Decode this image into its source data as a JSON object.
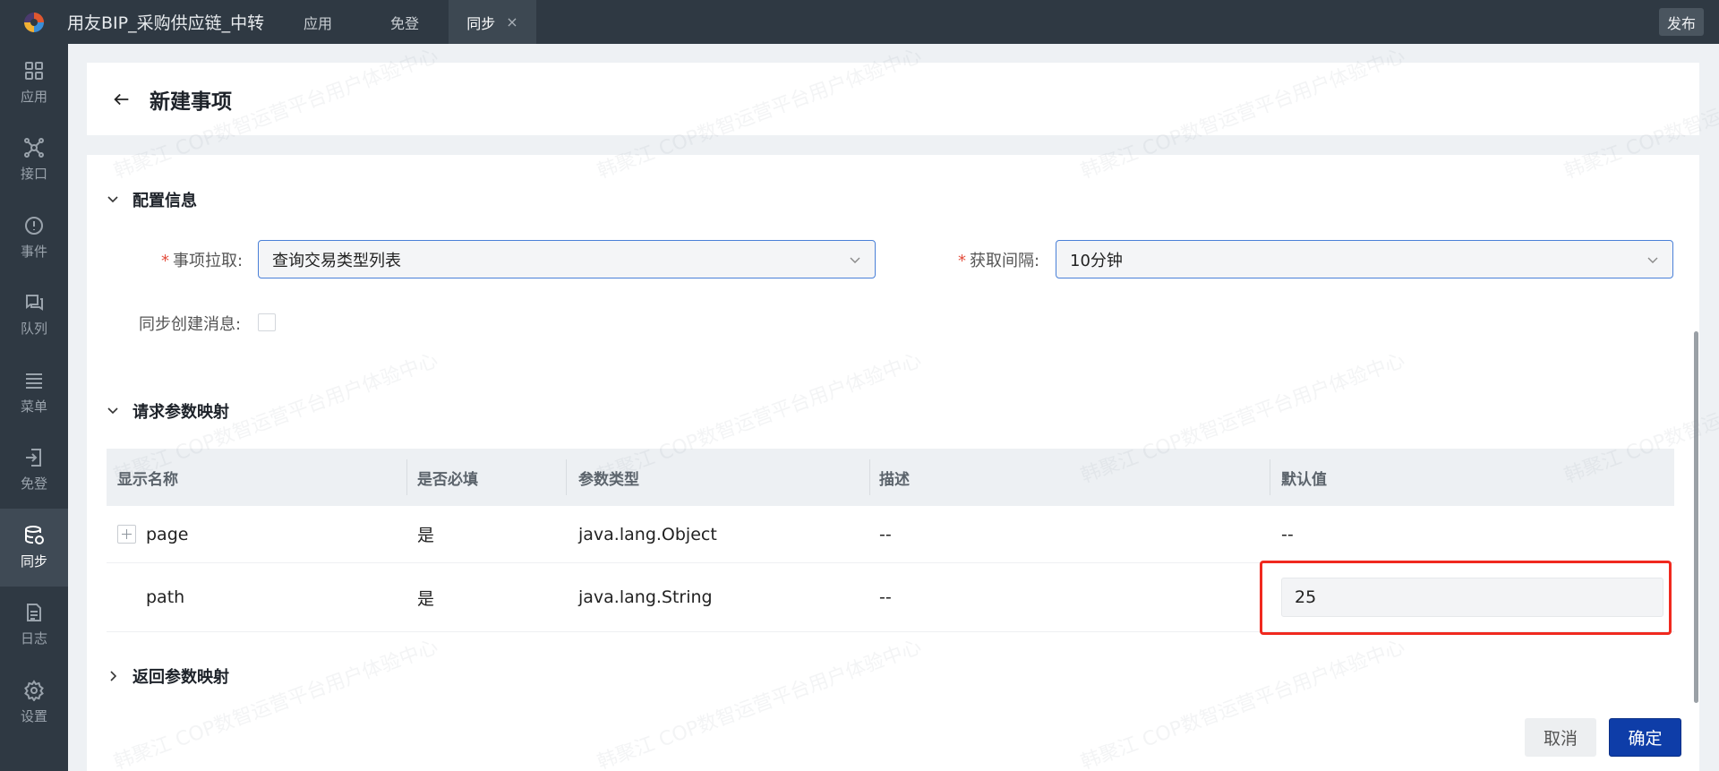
{
  "topbar": {
    "app_title": "用友BIP_采购供应链_中转",
    "tabs": [
      {
        "label": "应用"
      },
      {
        "label": "免登"
      },
      {
        "label": "同步",
        "close": "×"
      }
    ],
    "publish_label": "发布"
  },
  "sidebar": {
    "items": [
      {
        "label": "应用",
        "icon": "grid-icon"
      },
      {
        "label": "接口",
        "icon": "network-icon"
      },
      {
        "label": "事件",
        "icon": "alert-circle-icon"
      },
      {
        "label": "队列",
        "icon": "chat-icon"
      },
      {
        "label": "菜单",
        "icon": "menu-icon"
      },
      {
        "label": "免登",
        "icon": "login-icon"
      },
      {
        "label": "同步",
        "icon": "database-sync-icon",
        "active": true
      },
      {
        "label": "日志",
        "icon": "document-icon"
      },
      {
        "label": "设置",
        "icon": "gear-icon"
      }
    ]
  },
  "header": {
    "title": "新建事项"
  },
  "config": {
    "section_title": "配置信息",
    "item_pull": {
      "required_mark": "*",
      "label": "事项拉取:",
      "value": "查询交易类型列表"
    },
    "interval": {
      "required_mark": "*",
      "label": "获取间隔:",
      "value": "10分钟"
    },
    "sync_msg": {
      "label": "同步创建消息:",
      "checked": false
    }
  },
  "request_mapping": {
    "section_title": "请求参数映射",
    "columns": [
      "显示名称",
      "是否必填",
      "参数类型",
      "描述",
      "默认值"
    ],
    "rows": [
      {
        "name": "page",
        "required": "是",
        "type": "java.lang.Object",
        "desc": "--",
        "default": "--",
        "expandable": true
      },
      {
        "name": "path",
        "required": "是",
        "type": "java.lang.String",
        "desc": "--",
        "default": "25",
        "editable": true
      }
    ]
  },
  "response_mapping": {
    "section_title": "返回参数映射"
  },
  "footer": {
    "cancel_label": "取消",
    "confirm_label": "确定"
  },
  "watermark": "韩聚江 COP数智运营平台用户体验中心",
  "colors": {
    "topbar_bg": "#2f3943",
    "primary": "#0e3da8",
    "highlight": "#f0291f",
    "required": "#e34d3c"
  }
}
